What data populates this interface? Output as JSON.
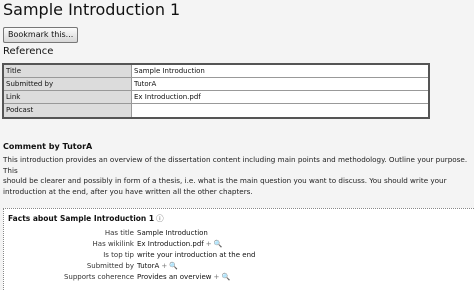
{
  "page": {
    "title": "Sample Introduction 1"
  },
  "toolbar": {
    "bookmark_label": "Bookmark this..."
  },
  "reference": {
    "heading": "Reference",
    "rows": [
      {
        "label": "Title",
        "value": "Sample Introduction"
      },
      {
        "label": "Submitted by",
        "value": "TutorA"
      },
      {
        "label": "Link",
        "value": "Ex Introduction.pdf"
      },
      {
        "label": "Podcast",
        "value": ""
      }
    ]
  },
  "comment": {
    "heading": "Comment by TutorA",
    "body": "This introduction provides an overview of the dissertation content including main points and methodology. Outline your purpose. This\nshould be clearer and possibly in form of a thesis, i.e. what is the main question you want to discuss. You should write your\nintroduction at the end, after you have written all the other chapters."
  },
  "facts": {
    "heading": "Facts about Sample Introduction 1",
    "info_icon": "info-icon",
    "rows": [
      {
        "key": "Has title",
        "value": "Sample Introduction",
        "icons": ""
      },
      {
        "key": "Has wikilink",
        "value": "Ex Introduction.pdf",
        "icons": "+ 🔍"
      },
      {
        "key": "Is top tip",
        "value": "write your introduction at the end",
        "icons": ""
      },
      {
        "key": "Submitted by",
        "value": "TutorA",
        "icons": "+ 🔍"
      },
      {
        "key": "Supports coherence",
        "value": "Provides an overview",
        "icons": "+ 🔍"
      }
    ]
  }
}
